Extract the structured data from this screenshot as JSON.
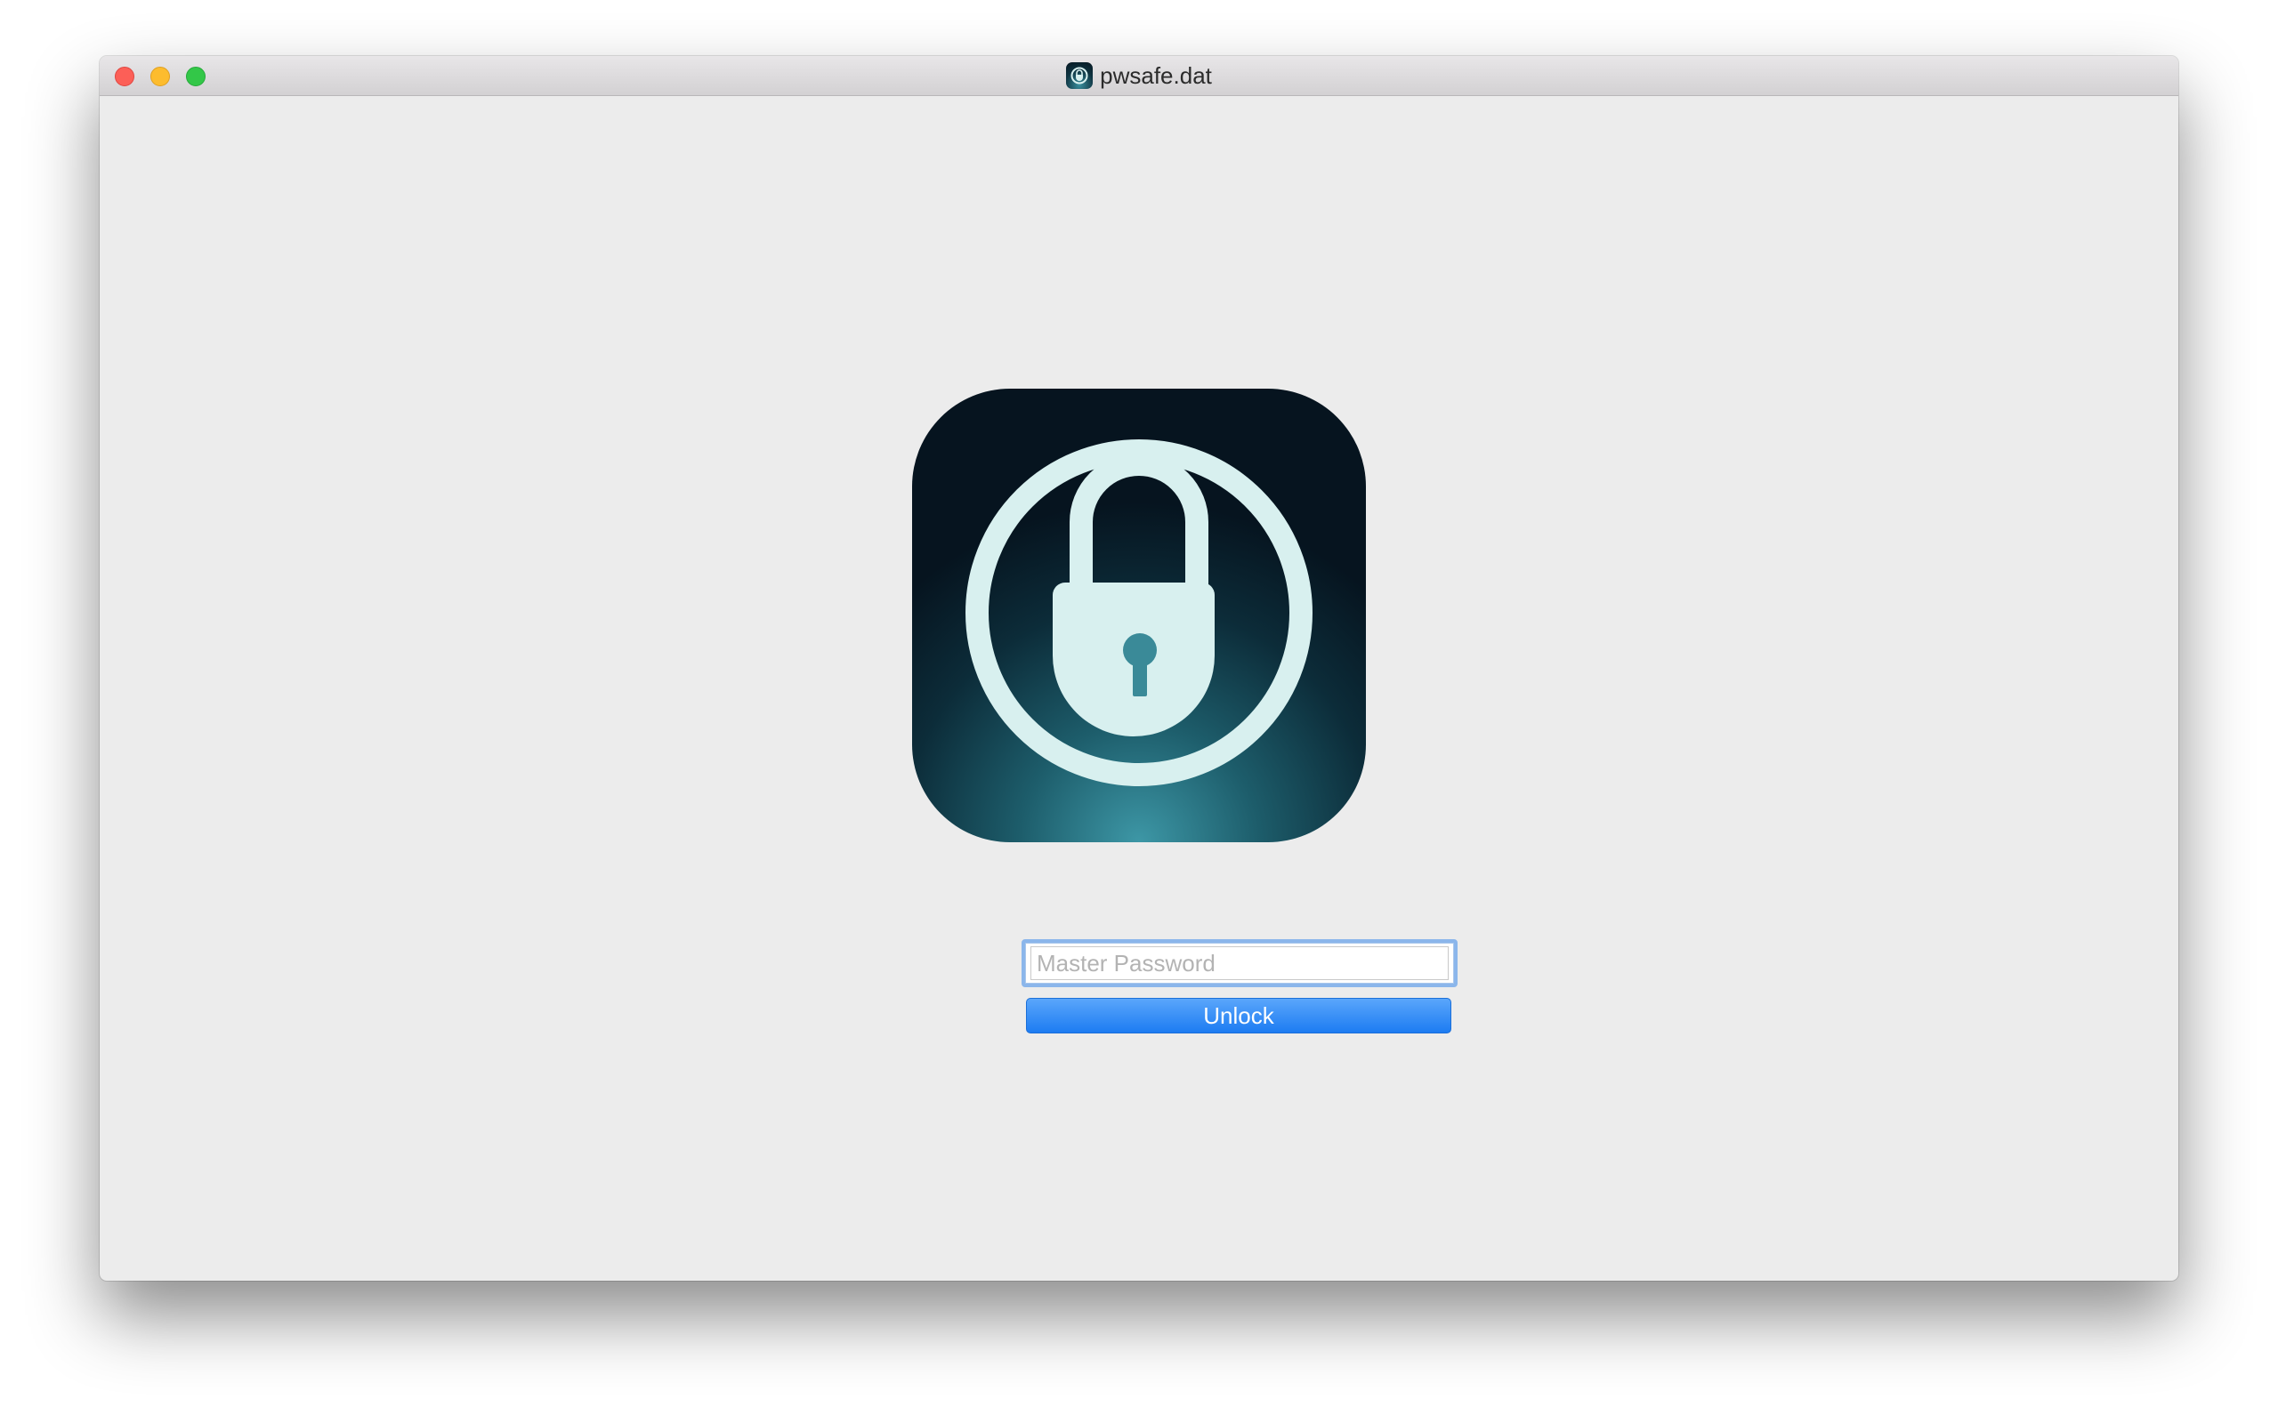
{
  "window": {
    "title": "pwsafe.dat",
    "title_icon": "lock-app-icon"
  },
  "traffic_lights": {
    "close_color": "#fc5f57",
    "minimize_color": "#fdbc2e",
    "maximize_color": "#33c748"
  },
  "app_icon": {
    "name": "padlock-icon",
    "background_colors": [
      "#06141f",
      "#3d97a6"
    ],
    "glyph_color": "#d8f0ef"
  },
  "unlock_form": {
    "password_value": "",
    "password_placeholder": "Master Password",
    "unlock_label": "Unlock",
    "button_color": "#1d7cf2",
    "focus_ring_color": "#8bb6eb"
  }
}
